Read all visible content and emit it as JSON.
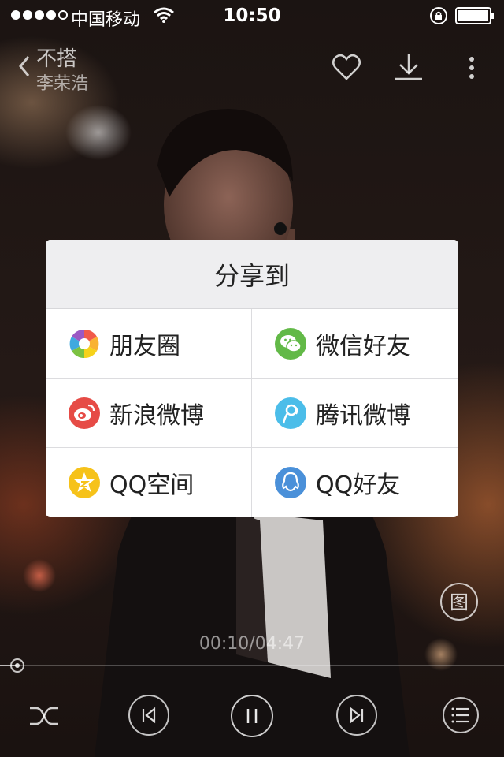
{
  "status_bar": {
    "carrier": "中国移动",
    "time": "10:50",
    "signal_bars_filled": 4,
    "signal_bars_total": 5
  },
  "now_playing": {
    "title": "不搭",
    "artist": "李荣浩"
  },
  "share": {
    "title": "分享到",
    "options": [
      {
        "label": "朋友圈",
        "icon": "moments-icon",
        "color": "#f0a030"
      },
      {
        "label": "微信好友",
        "icon": "wechat-icon",
        "color": "#62b947"
      },
      {
        "label": "新浪微博",
        "icon": "weibo-icon",
        "color": "#e64b46"
      },
      {
        "label": "腾讯微博",
        "icon": "tencent-weibo-icon",
        "color": "#4bbde9"
      },
      {
        "label": "QQ空间",
        "icon": "qzone-icon",
        "color": "#f6c21a"
      },
      {
        "label": "QQ好友",
        "icon": "qq-icon",
        "color": "#4a90d9"
      }
    ]
  },
  "player": {
    "progress_text": "00:10/04:47",
    "progress_fraction": 0.035,
    "album_art_label": "图"
  }
}
